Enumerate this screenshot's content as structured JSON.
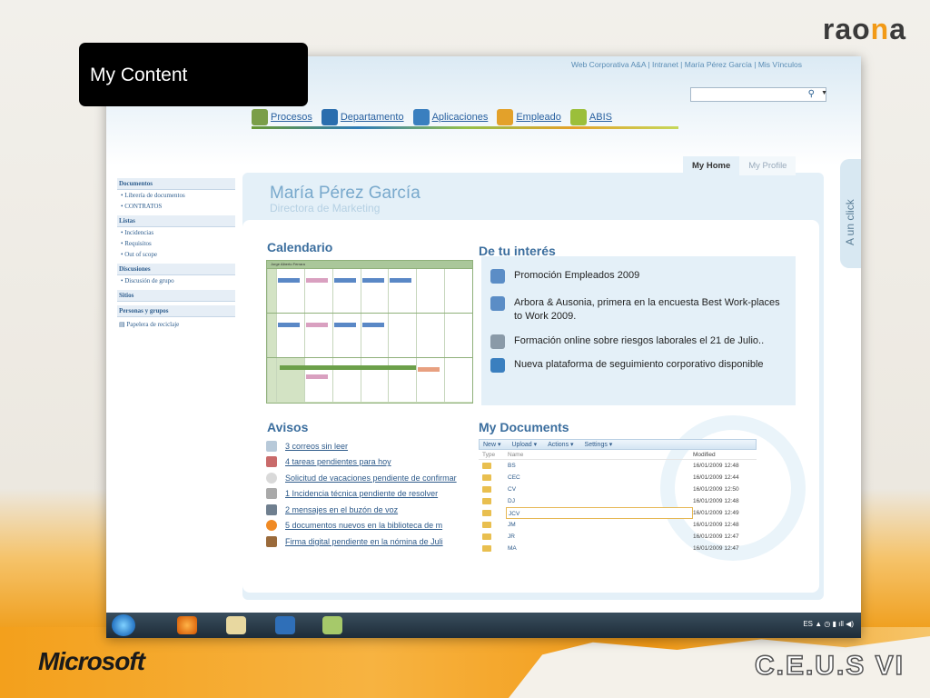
{
  "brand": {
    "left": "rao",
    "dot": "n",
    "right": "a",
    "microsoft": "Microsoft",
    "event": "C.E.U.S VI"
  },
  "slide_title": "My Content",
  "top_links": "Web Corporativa A&A | Intranet | María Pérez García | Mis Vínculos",
  "nav": [
    {
      "label": "Procesos",
      "color": "#7a9e48"
    },
    {
      "label": "Departamento",
      "color": "#2b6eae"
    },
    {
      "label": "Aplicaciones",
      "color": "#3a7fbf"
    },
    {
      "label": "Empleado",
      "color": "#e3a12a"
    },
    {
      "label": "ABIS",
      "color": "#9bbf3a"
    }
  ],
  "quick_launch": {
    "documentos": {
      "head": "Documentos",
      "items": [
        "Librería de documentos",
        "CONTRATOS"
      ]
    },
    "listas": {
      "head": "Listas",
      "items": [
        "Incidencias",
        "Requisitos",
        "Out of scope"
      ]
    },
    "discusiones": {
      "head": "Discusiones",
      "items": [
        "Discusión de grupo"
      ]
    },
    "sitios": "Sitios",
    "personas": "Personas y grupos",
    "recycle": "Papelera de reciclaje"
  },
  "tabs": {
    "home": "My Home",
    "profile": "My Profile"
  },
  "profile": {
    "name": "María Pérez García",
    "role": "Directora de Marketing"
  },
  "calendar": {
    "title": "Calendario",
    "header": "Jorge Alberto Ferrara"
  },
  "interest": {
    "title": "De tu interés",
    "items": [
      "Promoción Empleados 2009",
      "Arbora & Ausonia, primera en la encuesta Best Work-places to Work 2009.",
      "Formación online sobre riesgos laborales el 21 de Julio..",
      "Nueva plataforma de seguimiento corporativo disponible"
    ]
  },
  "avisos": {
    "title": "Avisos",
    "items": [
      "3 correos sin leer",
      "4 tareas pendientes para hoy",
      "Solicitud de vacaciones pendiente de confirmar",
      "1 Incidencia técnica pendiente de resolver",
      "2 mensajes en el buzón de voz",
      "5 documentos nuevos en la biblioteca de m",
      "Firma digital pendiente en la nómina de Juli"
    ]
  },
  "documents": {
    "title": "My Documents",
    "toolbar": [
      "New ▾",
      "Upload ▾",
      "Actions ▾",
      "Settings ▾"
    ],
    "columns": {
      "type": "Type",
      "name": "Name",
      "modified": "Modified"
    },
    "rows": [
      {
        "name": "BS",
        "modified": "16/01/2009 12:48"
      },
      {
        "name": "CEC",
        "modified": "16/01/2009 12:44"
      },
      {
        "name": "CV",
        "modified": "16/01/2009 12:50"
      },
      {
        "name": "DJ",
        "modified": "16/01/2009 12:48"
      },
      {
        "name": "JCV",
        "modified": "16/01/2009 12:49"
      },
      {
        "name": "JM",
        "modified": "16/01/2009 12:48"
      },
      {
        "name": "JR",
        "modified": "16/01/2009 12:47"
      },
      {
        "name": "MA",
        "modified": "16/01/2009 12:47"
      }
    ]
  },
  "side_tab": "A un click",
  "taskbar": {
    "lang": "ES"
  }
}
